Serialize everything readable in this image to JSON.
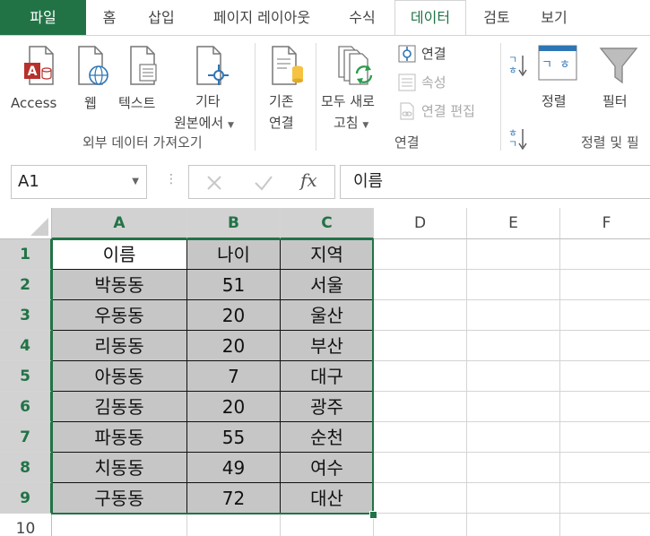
{
  "tabs": [
    {
      "label": "파일"
    },
    {
      "label": "홈"
    },
    {
      "label": "삽입"
    },
    {
      "label": "페이지 레이아웃"
    },
    {
      "label": "수식"
    },
    {
      "label": "데이터"
    },
    {
      "label": "검토"
    },
    {
      "label": "보기"
    }
  ],
  "ribbon": {
    "external": {
      "access": "Access",
      "web": "웹",
      "text": "텍스트",
      "other_line1": "기타",
      "other_line2": "원본에서",
      "group": "외부 데이터 가져오기"
    },
    "existing": {
      "line1": "기존",
      "line2": "연결"
    },
    "connections": {
      "refresh_line1": "모두 새로",
      "refresh_line2": "고침",
      "connections": "연결",
      "properties": "속성",
      "edit_links": "연결 편집",
      "group": "연결"
    },
    "sort": {
      "sort": "정렬",
      "filter": "필터",
      "group": "정렬 및 필"
    }
  },
  "formula_bar": {
    "name_box": "A1",
    "fx": "fx",
    "formula": "이름"
  },
  "grid": {
    "columns": [
      "A",
      "B",
      "C",
      "D",
      "E",
      "F"
    ],
    "rows": [
      "1",
      "2",
      "3",
      "4",
      "5",
      "6",
      "7",
      "8",
      "9",
      "10"
    ],
    "data": [
      [
        "이름",
        "나이",
        "지역"
      ],
      [
        "박동동",
        "51",
        "서울"
      ],
      [
        "우동동",
        "20",
        "울산"
      ],
      [
        "리동동",
        "20",
        "부산"
      ],
      [
        "아동동",
        "7",
        "대구"
      ],
      [
        "김동동",
        "20",
        "광주"
      ],
      [
        "파동동",
        "55",
        "순천"
      ],
      [
        "치동동",
        "49",
        "여수"
      ],
      [
        "구동동",
        "72",
        "대산"
      ]
    ]
  },
  "colors": {
    "accent": "#217346",
    "selection_fill": "#c6c6c6"
  }
}
